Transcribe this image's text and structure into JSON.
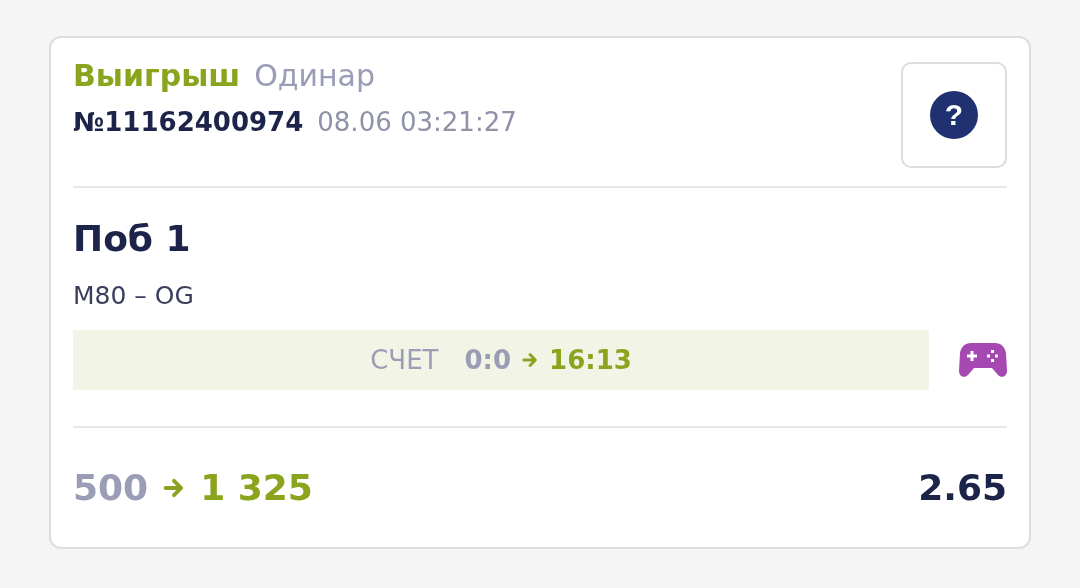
{
  "bet": {
    "status": {
      "text": "Выигрыш",
      "kind": "win"
    },
    "type": "Одинар",
    "number": "№11162400974",
    "datetime": "08.06 03:21:27",
    "help": "?"
  },
  "selection": {
    "outcome": "Поб 1",
    "event": "M80 – OG",
    "score": {
      "label": "СЧЕТ",
      "from": "0:0",
      "to": "16:13"
    }
  },
  "payout": {
    "stake": "500",
    "win": "1 325",
    "odds": "2.65"
  }
}
